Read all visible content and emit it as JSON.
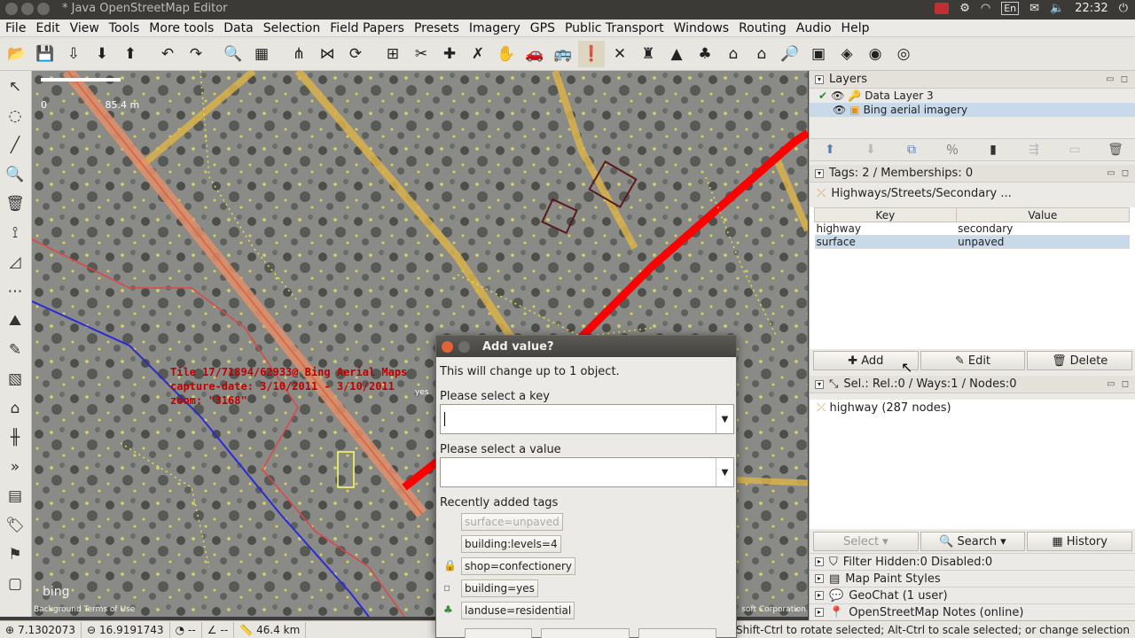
{
  "window": {
    "title": "* Java OpenStreetMap Editor"
  },
  "system": {
    "kb": "En",
    "time": "22:32"
  },
  "menu": [
    "File",
    "Edit",
    "View",
    "Tools",
    "More tools",
    "Data",
    "Selection",
    "Field Papers",
    "Presets",
    "Imagery",
    "GPS",
    "Public Transport",
    "Windows",
    "Routing",
    "Audio",
    "Help"
  ],
  "map": {
    "scale_min": "0",
    "scale_max": "85.4 m",
    "tile_line1": "Tile 17/71894/62933@ Bing Aerial Maps",
    "tile_line2": "capture-date: 3/10/2011 - 3/10/2011",
    "tile_line3": "zoom: \"3168\"",
    "bing": "bing",
    "attribution_left": "Background Terms of Use",
    "attribution_right": "soft Corporation",
    "yes_label": "yes"
  },
  "layers": {
    "title": "Layers",
    "items": [
      {
        "name": "Data Layer 3"
      },
      {
        "name": "Bing aerial imagery"
      }
    ]
  },
  "tags": {
    "header": "Tags: 2 / Memberships: 0",
    "preset": "Highways/Streets/Secondary ...",
    "col_key": "Key",
    "col_value": "Value",
    "rows": [
      {
        "key": "highway",
        "value": "secondary"
      },
      {
        "key": "surface",
        "value": "unpaved"
      }
    ],
    "add": "Add",
    "edit": "Edit",
    "delete": "Delete"
  },
  "selection": {
    "header": "Sel.: Rel.:0 / Ways:1 / Nodes:0",
    "item": "highway (287 nodes)",
    "select": "Select",
    "search": "Search",
    "history": "History"
  },
  "collapsed_panels": [
    "Filter Hidden:0 Disabled:0",
    "Map Paint Styles",
    "GeoChat (1 user)",
    "OpenStreetMap Notes (online)"
  ],
  "status": {
    "lat": "7.1302073",
    "lon": "16.9191743",
    "heading": "--",
    "angle": "--",
    "distance": "46.4 km",
    "hint": "Shift-Ctrl to rotate selected; Alt-Ctrl to scale selected; or change selection"
  },
  "dialog": {
    "title": "Add value?",
    "message": "This will change up to 1 object.",
    "key_label": "Please select a key",
    "value_label": "Please select a value",
    "recent_label": "Recently added tags",
    "recent": [
      {
        "text": "surface=unpaved",
        "enabled": false
      },
      {
        "text": "building:levels=4",
        "enabled": true
      },
      {
        "text": "shop=confectionery",
        "enabled": true
      },
      {
        "text": "building=yes",
        "enabled": true
      },
      {
        "text": "landuse=residential",
        "enabled": true
      }
    ]
  },
  "colors": {
    "road_yellow": "#d9b24a",
    "road_red": "#ff0000",
    "water_blue": "#2a2ad8",
    "boundary_red": "#e04545"
  }
}
